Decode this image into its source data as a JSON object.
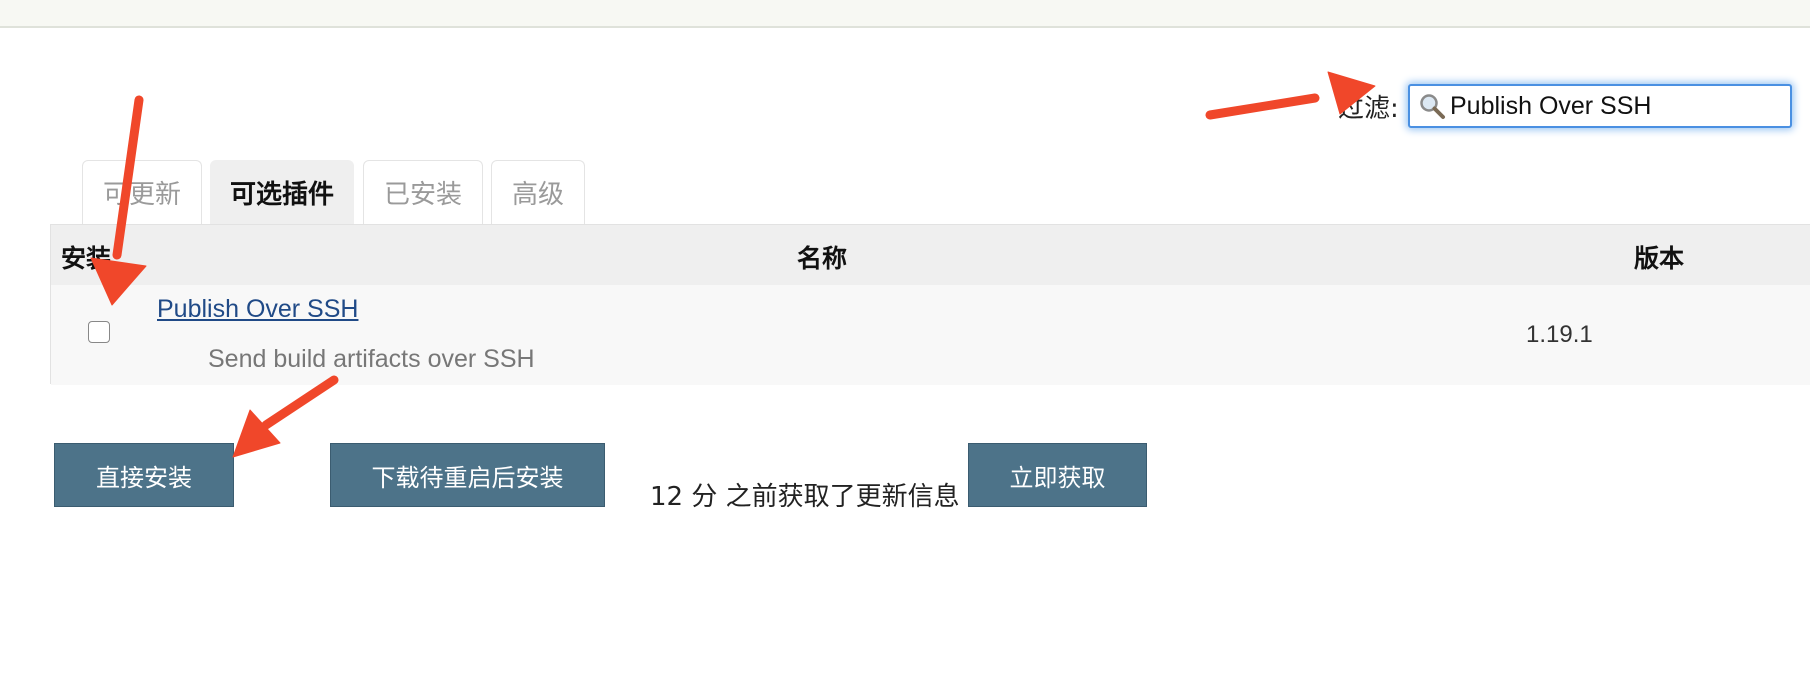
{
  "filter": {
    "label": "过滤:",
    "value": "Publish Over SSH"
  },
  "tabs": [
    {
      "label": "可更新"
    },
    {
      "label": "可选插件"
    },
    {
      "label": "已安装"
    },
    {
      "label": "高级"
    }
  ],
  "table": {
    "headers": {
      "install": "安装",
      "name": "名称",
      "version": "版本"
    },
    "rows": [
      {
        "checked": false,
        "name": "Publish Over SSH",
        "description": "Send build artifacts over SSH",
        "version": "1.19.1"
      }
    ]
  },
  "actions": {
    "install_now": "直接安装",
    "download_restart": "下载待重启后安装",
    "update_info": "12 分 之前获取了更新信息",
    "fetch_now": "立即获取"
  },
  "colors": {
    "button_bg": "#4d7389",
    "annotation_arrow": "#f0472a",
    "link": "#204a87"
  }
}
